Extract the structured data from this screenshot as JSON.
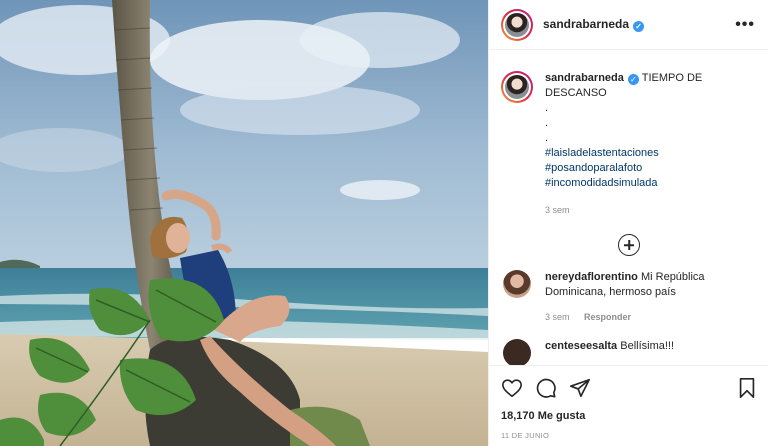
{
  "post": {
    "username": "sandrabarneda",
    "verified_icon": "✓",
    "more_label": "•••"
  },
  "caption": {
    "username": "sandrabarneda",
    "text": "TIEMPO DE DESCANSO",
    "dots": [
      ".",
      ".",
      "."
    ],
    "hashtags": [
      "#laisladelastentaciones",
      "#posandoparalafoto",
      "#incomodidadsimulada"
    ],
    "age": "3 sem"
  },
  "comments": [
    {
      "username": "nereydaflorentino",
      "text": "Mi República Dominicana, hermoso país",
      "age": "3 sem",
      "reply_label": "Responder"
    },
    {
      "username": "centeseesalta",
      "text": "Bellísima!!!",
      "age": "",
      "reply_label": ""
    }
  ],
  "actions": {
    "likes": "18,170 Me gusta",
    "date": "11 DE JUNIO",
    "icons": [
      "heart-icon",
      "comment-icon",
      "share-icon",
      "bookmark-icon"
    ]
  },
  "colors": {
    "link": "#00376b",
    "verified": "#3897f0",
    "muted": "#8e8e8e"
  }
}
